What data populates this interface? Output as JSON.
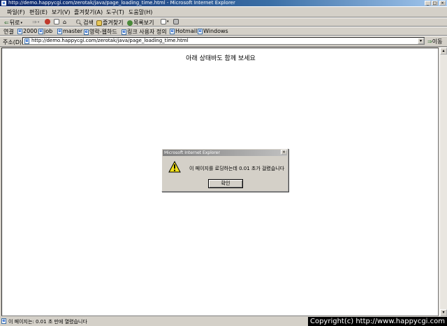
{
  "window": {
    "title": "http://demo.happycgi.com/zerotak/java/page_loading_time.html - Microsoft Internet Explorer",
    "buttons": {
      "minimize": "_",
      "maximize": "□",
      "close": "×"
    }
  },
  "menu": [
    "파일(F)",
    "편집(E)",
    "보기(V)",
    "즐겨찾기(A)",
    "도구(T)",
    "도움말(H)"
  ],
  "toolbar": {
    "back": "뒤로",
    "search": "검색",
    "favorites": "즐겨찾기",
    "history": "목록보기"
  },
  "links": {
    "label": "연결",
    "items": [
      "2000",
      "job",
      "master",
      "영락-웹하드",
      "링크 사용자 정의",
      "Hotmail",
      "Windows"
    ]
  },
  "address": {
    "label": "주소(D)",
    "url": "http://demo.happycgi.com/zerotak/java/page_loading_time.html",
    "go_label": "이동"
  },
  "page": {
    "heading": "아래 상태바도 함께 보세요"
  },
  "dialog": {
    "title": "Microsoft Internet Explorer",
    "message": "이 페이지를 로딩하는데 0.01 초가 걸렸습니다",
    "ok_label": "확인"
  },
  "status": {
    "text": "이 페이지는: 0.01 초 만에 열렸습니다"
  },
  "copyright": "Copyright(c) http://www.happycgi.com"
}
